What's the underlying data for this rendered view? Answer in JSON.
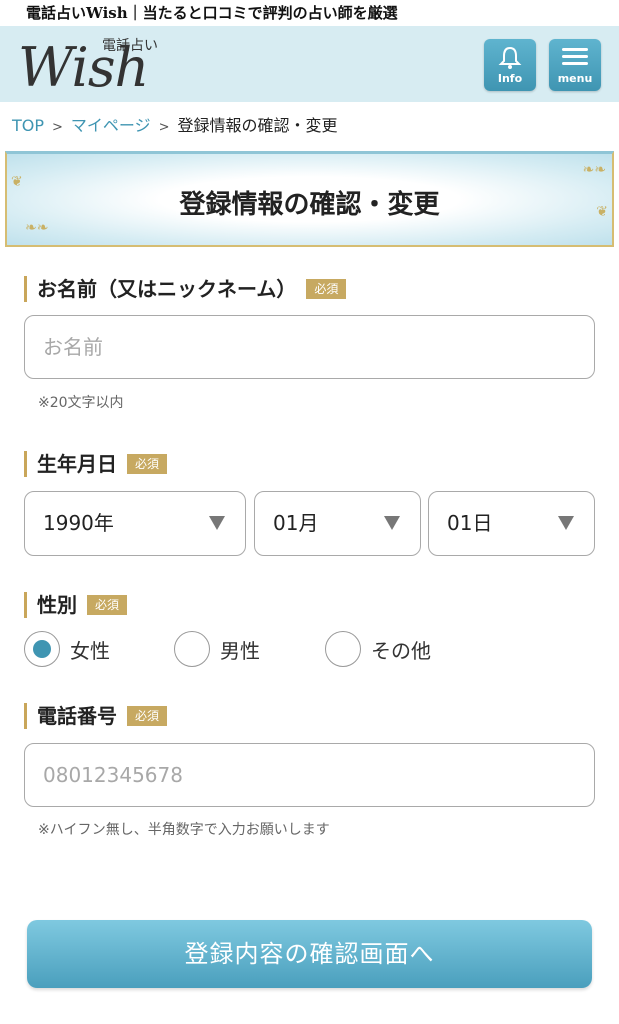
{
  "tagline": "電話占いWish｜当たると口コミで評判の占い師を厳選",
  "header": {
    "logo_sub": "電話占い",
    "logo_main": "Wish",
    "info_label": "Info",
    "menu_label": "menu",
    "bg_color": "#d7ecf2",
    "button_color": "#4aa3c1"
  },
  "breadcrumb": {
    "items": [
      "TOP",
      "マイページ",
      "登録情報の確認・変更"
    ],
    "separator": ">"
  },
  "banner": {
    "title": "登録情報の確認・変更"
  },
  "required_badge": "必須",
  "form": {
    "name": {
      "label": "お名前（又はニックネーム）",
      "placeholder": "お名前",
      "value": "",
      "note": "※20文字以内"
    },
    "birthdate": {
      "label": "生年月日",
      "year": "1990年",
      "month": "01月",
      "day": "01日"
    },
    "gender": {
      "label": "性別",
      "options": [
        "女性",
        "男性",
        "その他"
      ],
      "selected": "女性"
    },
    "phone": {
      "label": "電話番号",
      "placeholder": "08012345678",
      "value": "",
      "note": "※ハイフン無し、半角数字で入力お願いします"
    }
  },
  "submit_label": "登録内容の確認画面へ",
  "colors": {
    "accent": "#3f95b2",
    "badge": "#c7a961",
    "label_bar": "#c9a65a"
  }
}
